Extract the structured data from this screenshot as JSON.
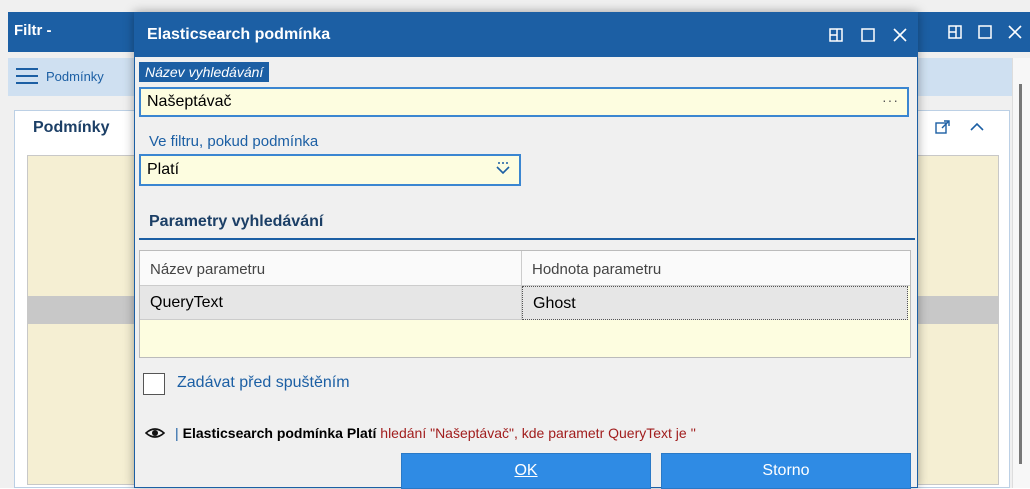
{
  "background": {
    "window_title": "Filtr -",
    "toolbar_label": "Podmínky",
    "panel_title": "Podmínky"
  },
  "dialog": {
    "title": "Elasticsearch podmínka",
    "name_label": "Název vyhledávání",
    "name_value": "Našeptávač",
    "name_dots": "···",
    "condition_label": "Ve filtru, pokud podmínka",
    "condition_value": "Platí",
    "params_title": "Parametry vyhledávání",
    "params_table": {
      "headers": [
        "Název parametru",
        "Hodnota parametru"
      ],
      "rows": [
        {
          "name": "QueryText",
          "value": "Ghost"
        }
      ]
    },
    "ask_before_run_label": "Zadávat před spuštěním",
    "summary": {
      "separator": "|",
      "bold": "Elasticsearch podmínka Platí",
      "rest": " hledání \"Našeptávač\", kde parametr QueryText je ''"
    },
    "ok_label": "OK",
    "cancel_label": "Storno"
  },
  "colors": {
    "accent": "#1c5fa4",
    "button": "#2f8be4",
    "input_bg": "#fdfde0",
    "summary_red": "#a11d1d"
  },
  "icons": [
    "menu-icon",
    "restore-icon",
    "maximize-icon",
    "close-icon",
    "popout-icon",
    "chevron-up-icon",
    "dropdown-icon",
    "eye-icon"
  ]
}
